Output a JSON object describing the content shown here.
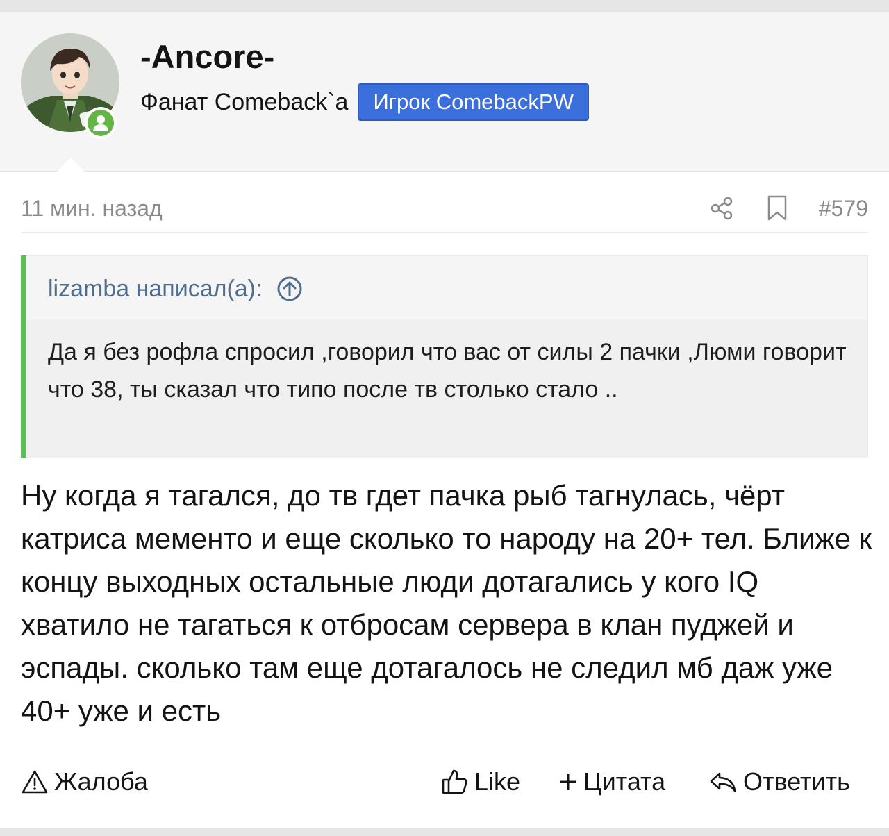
{
  "author": {
    "username": "-Ancore-",
    "user_title": "Фанат Comeback`a",
    "banner": "Игрок ComebackPW",
    "online_status_icon": "user-icon",
    "colors": {
      "banner_bg": "#3b6fdc",
      "online": "#63b545"
    }
  },
  "post": {
    "time": "11 мин. назад",
    "number": "#579",
    "quote": {
      "author_line": "lizamba написал(а):",
      "text": "Да я без рофла спросил ,говорил что вас от силы 2 пачки ,Люми говорит что 38, ты сказал что типо после тв столько стало .."
    },
    "body": "Ну когда я тагался, до тв гдет пачка рыб тагнулась, чёрт катриса мементо и еще сколько то народу на 20+ тел. Ближе к концу выходных остальные люди дотагались у кого IQ хватило не тагаться к отбросам сервера в клан пуджей и эспады. сколько там еще дотагалось не следил мб даж уже 40+ уже и есть"
  },
  "footer": {
    "report": "Жалоба",
    "like": "Like",
    "quote": "Цитата",
    "reply": "Ответить"
  },
  "colors": {
    "quote_bar": "#5fbd59",
    "quote_author": "#4f6d8c",
    "muted": "#8a8a8a"
  }
}
